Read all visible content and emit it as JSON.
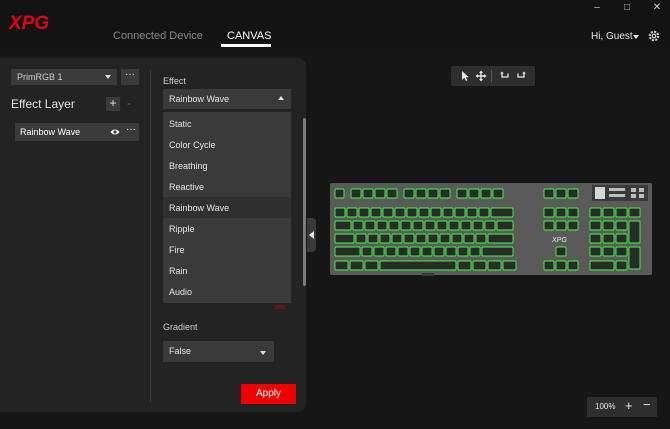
{
  "app": {
    "brand": "XPG",
    "brand_color": "#e60012",
    "window_controls": [
      "minimize",
      "maximize",
      "close"
    ]
  },
  "nav": {
    "tabs": [
      {
        "label": "Connected Device",
        "active": false
      },
      {
        "label": "CANVAS",
        "active": true
      }
    ]
  },
  "user": {
    "greeting": "Hi, Guest",
    "settings_icon": "gear-icon"
  },
  "sidebar": {
    "profile": {
      "value": "PrimRGB 1",
      "more_label": "···"
    },
    "effect_layer_title": "Effect Layer",
    "add_label": "+",
    "remove_label": "-",
    "layers": [
      {
        "name": "Rainbow Wave",
        "visible": true,
        "more_label": "···"
      }
    ]
  },
  "effect": {
    "label": "Effect",
    "selected": "Rainbow Wave",
    "options": [
      "Static",
      "Color Cycle",
      "Breathing",
      "Reactive",
      "Rainbow Wave",
      "Ripple",
      "Fire",
      "Rain",
      "Audio"
    ],
    "selected_index": 4,
    "dropdown_open": true
  },
  "gradient": {
    "label": "Gradient",
    "value": "False"
  },
  "apply_label": "Apply",
  "apply_color": "#ee0000",
  "canvas": {
    "tools": [
      "cursor-icon",
      "move-icon",
      "undo-icon",
      "redo-icon"
    ],
    "keyboard": {
      "brand_text": "XPG",
      "backlight_color": "#3cff3c"
    },
    "zoom": {
      "level": "100%",
      "plus": "+",
      "minus": "−"
    }
  }
}
